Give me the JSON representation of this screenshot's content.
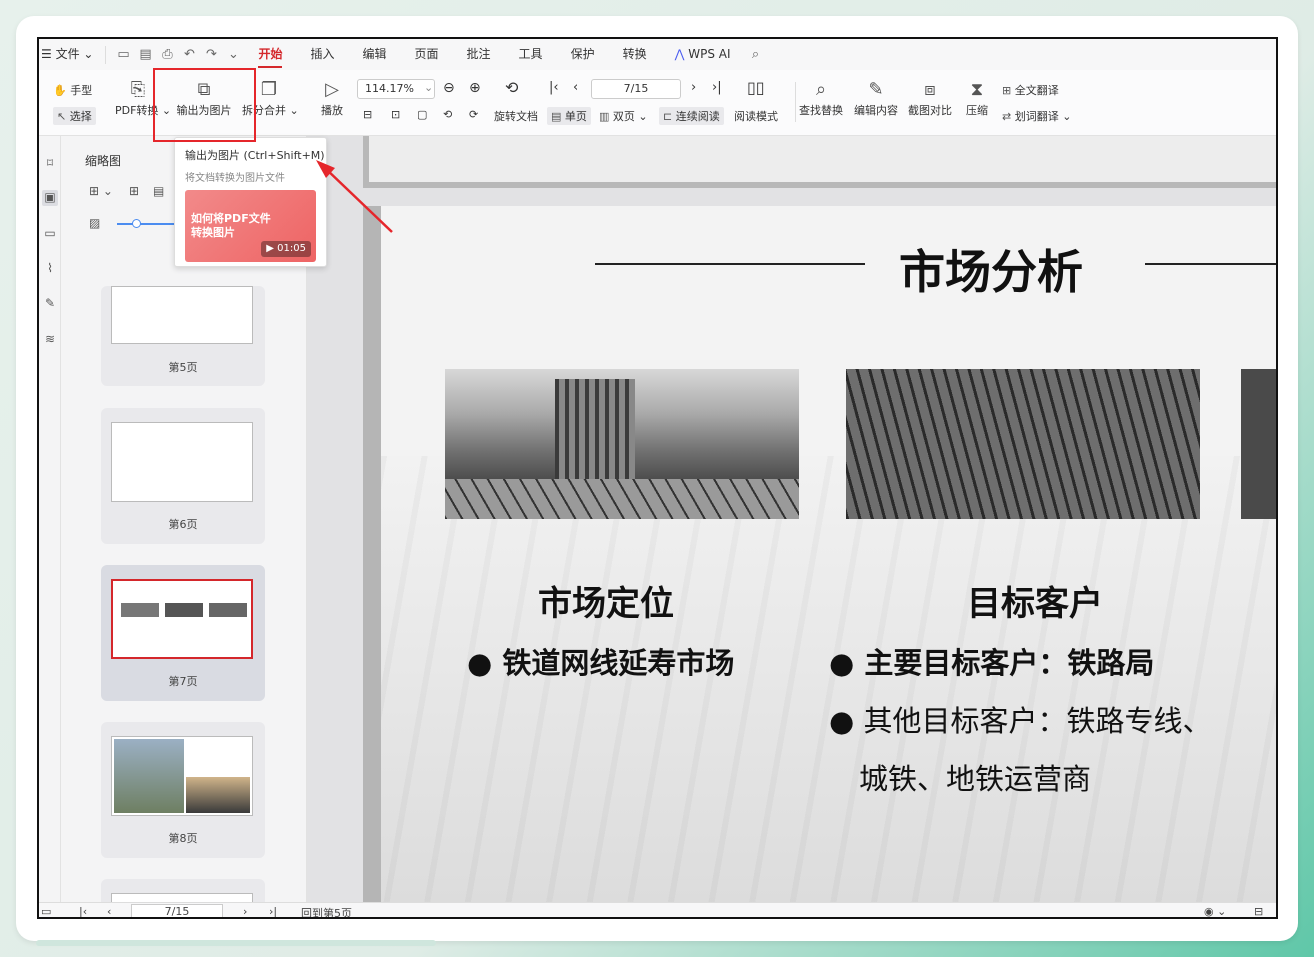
{
  "menubar": {
    "file": "文件",
    "tabs": [
      "开始",
      "插入",
      "编辑",
      "页面",
      "批注",
      "工具",
      "保护",
      "转换"
    ],
    "wps_ai": "WPS AI"
  },
  "ribbon": {
    "hand": "手型",
    "select": "选择",
    "pdf_convert": "PDF转换",
    "export_image": "输出为图片",
    "split_merge": "拆分合并",
    "play": "播放",
    "zoom_value": "114.17%",
    "page_value": "7/15",
    "rotate": "旋转文档",
    "single": "单页",
    "double": "双页",
    "continuous": "连续阅读",
    "read_mode": "阅读模式",
    "find_replace": "查找替换",
    "edit_content": "编辑内容",
    "screenshot_compare": "截图对比",
    "compress": "压缩",
    "full_translate": "全文翻译",
    "word_translate": "划词翻译"
  },
  "tooltip": {
    "title": "输出为图片 (Ctrl+Shift+M)",
    "desc": "将文档转换为图片文件",
    "video_title": "如何将PDF文件转换图片",
    "video_duration": "01:05"
  },
  "thumbs": {
    "panel_title": "缩略图",
    "pages": [
      "第5页",
      "第6页",
      "第7页",
      "第8页"
    ],
    "selected_page": "第7页"
  },
  "slide": {
    "title": "市场分析",
    "left_heading": "市场定位",
    "left_bullet": "铁道网线延寿市场",
    "right_heading": "目标客户",
    "right_bullet1": "主要目标客户：铁路局",
    "right_bullet2_line1": "其他目标客户：铁路专线、",
    "right_bullet2_line2": "城铁、地铁运营商"
  },
  "status": {
    "page_value": "7/15",
    "back_to": "回到第5页"
  }
}
